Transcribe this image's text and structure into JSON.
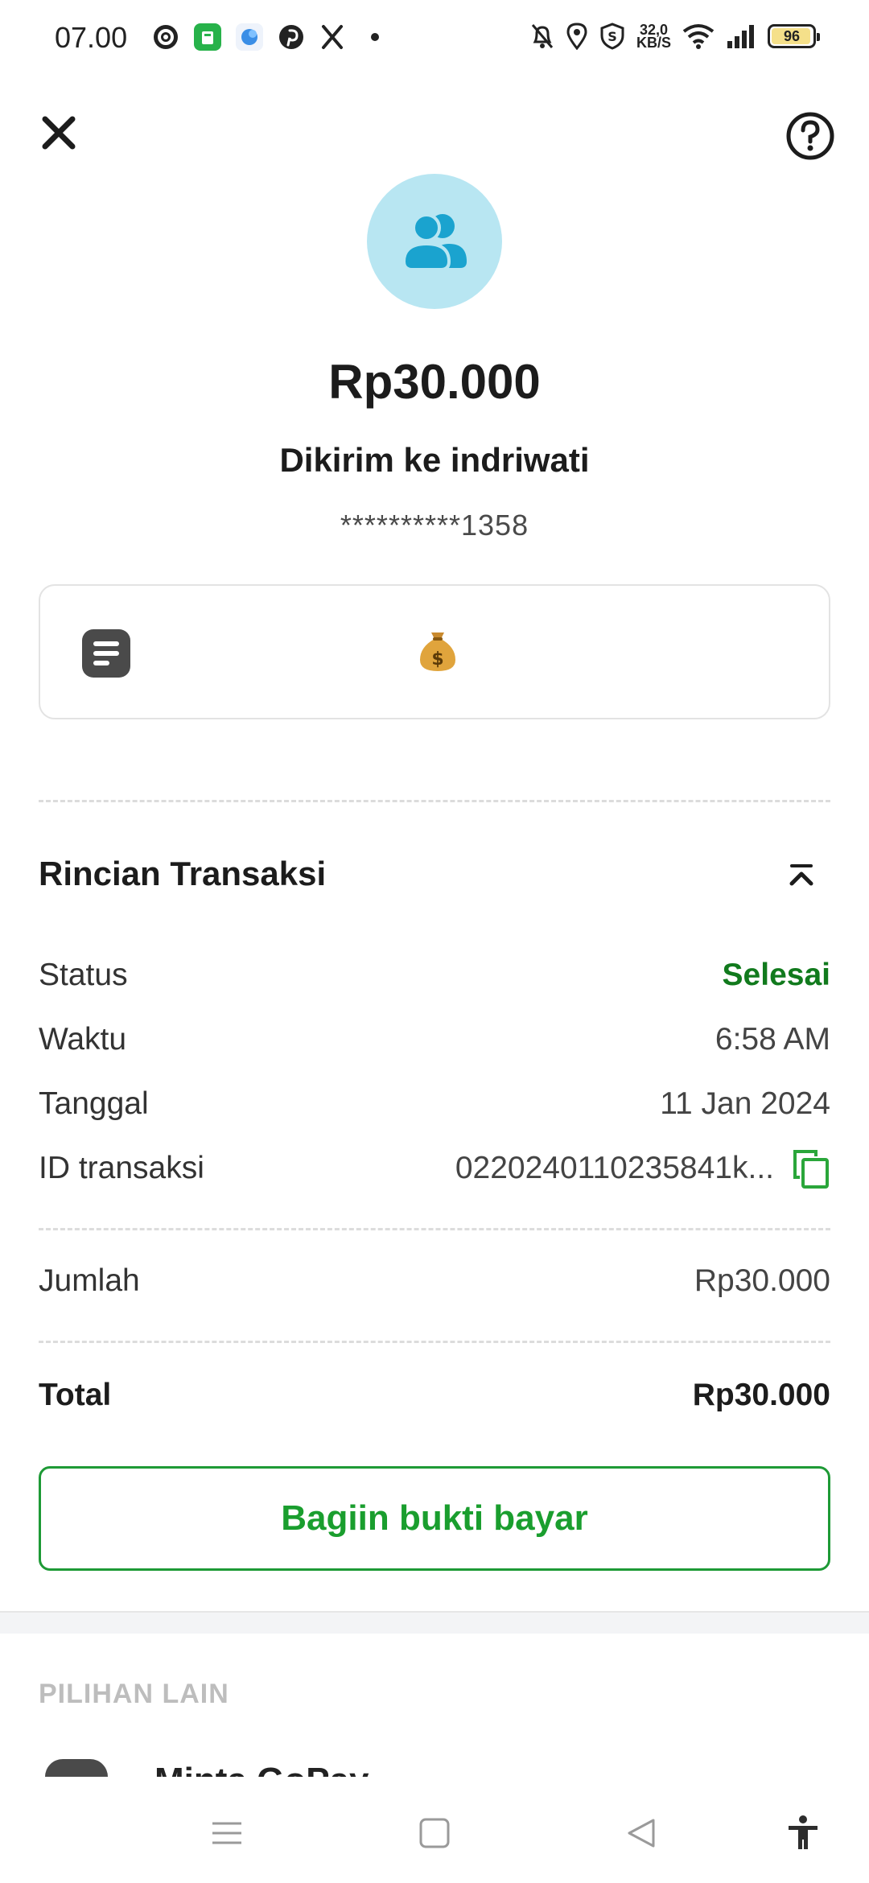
{
  "status_bar": {
    "time": "07.00",
    "network_speed_value": "32,0",
    "network_speed_unit": "KB/S",
    "battery": "96",
    "battery_level": 0.96
  },
  "header": {
    "amount": "Rp30.000",
    "sent_to": "Dikirim ke indriwati",
    "account_masked": "**********1358"
  },
  "details": {
    "title": "Rincian Transaksi",
    "status_label": "Status",
    "status_value": "Selesai",
    "time_label": "Waktu",
    "time_value": "6:58 AM",
    "date_label": "Tanggal",
    "date_value": "11 Jan 2024",
    "id_label": "ID transaksi",
    "id_value": "0220240110235841k...",
    "amount_label": "Jumlah",
    "amount_value": "Rp30.000",
    "total_label": "Total",
    "total_value": "Rp30.000"
  },
  "actions": {
    "share_label": "Bagiin bukti bayar"
  },
  "other": {
    "title": "PILIHAN LAIN",
    "item_label": "Minta GoPay"
  },
  "colors": {
    "accent_green": "#1a9e2e",
    "status_green": "#117a1d",
    "avatar_bg": "#b8e6f2",
    "avatar_icon": "#1aa3cf"
  }
}
